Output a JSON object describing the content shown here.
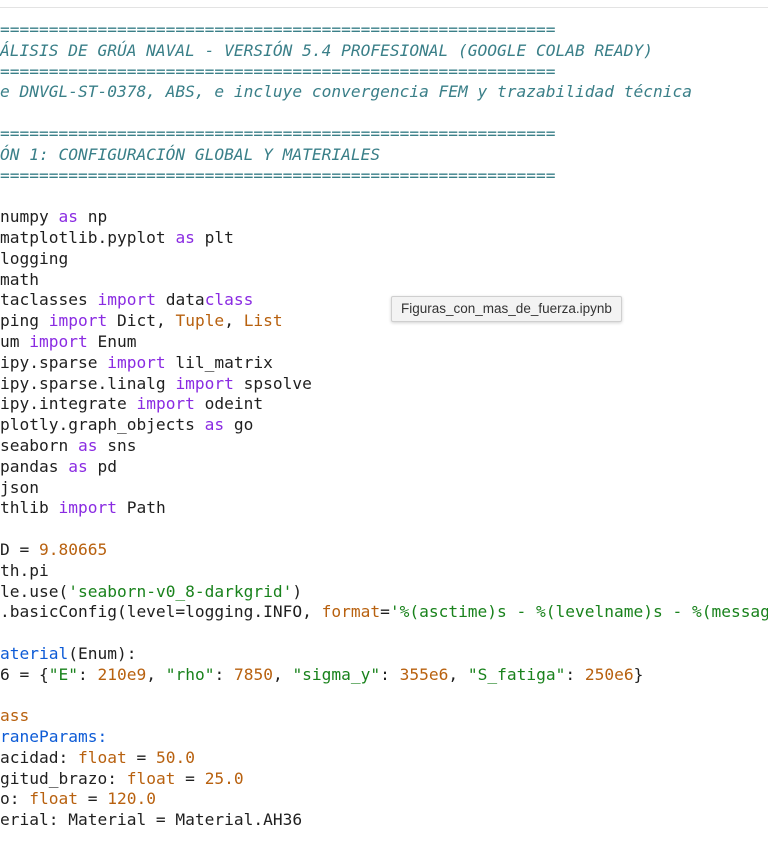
{
  "tooltip": {
    "text": "Figuras_con_mas_de_fuerza.ipynb"
  },
  "code": {
    "l01": "=========================================================",
    "l02": "ÁLISIS DE GRÚA NAVAL - VERSIÓN 5.4 PROFESIONAL (GOOGLE COLAB READY)",
    "l03": "=========================================================",
    "l04": "e DNVGL-ST-0378, ABS, e incluye convergencia FEM y trazabilidad técnica",
    "l05": "",
    "l06": "=========================================================",
    "l07": "ÓN 1: CONFIGURACIÓN GLOBAL Y MATERIALES",
    "l08": "=========================================================",
    "l09": "",
    "l10a": "numpy ",
    "l10b": "as",
    "l10c": " np",
    "l11a": "matplotlib.pyplot ",
    "l11b": "as",
    "l11c": " plt",
    "l12": "logging",
    "l13": "math",
    "l14a": "taclasses ",
    "l14b": "import",
    "l14c": " data",
    "l14d": "class",
    "l15a": "ping ",
    "l15b": "import",
    "l15c": " Dict, ",
    "l15d": "Tuple",
    "l15e": ", ",
    "l15f": "List",
    "l16a": "um ",
    "l16b": "import",
    "l16c": " Enum",
    "l17a": "ipy.sparse ",
    "l17b": "import",
    "l17c": " lil_matrix",
    "l18a": "ipy.sparse.linalg ",
    "l18b": "import",
    "l18c": " spsolve",
    "l19a": "ipy.integrate ",
    "l19b": "import",
    "l19c": " odeint",
    "l20a": "plotly.graph_objects ",
    "l20b": "as",
    "l20c": " go",
    "l21a": "seaborn ",
    "l21b": "as",
    "l21c": " sns",
    "l22a": "pandas ",
    "l22b": "as",
    "l22c": " pd",
    "l23": "json",
    "l24a": "thlib ",
    "l24b": "import",
    "l24c": " Path",
    "l25": "",
    "l26a": "D = ",
    "l26b": "9.80665",
    "l27": "th.pi",
    "l28a": "le.use(",
    "l28b": "'seaborn-v0_8-darkgrid'",
    "l28c": ")",
    "l29a": ".basicConfig(level=logging.INFO, ",
    "l29b": "format",
    "l29c": "=",
    "l29d": "'%(asctime)s - %(levelname)s - %(message",
    "l30": "",
    "l31a": "aterial",
    "l31b": "(Enum):",
    "l32a": "6 = {",
    "l32b": "\"E\"",
    "l32c": ": ",
    "l32d": "210e9",
    "l32e": ", ",
    "l32f": "\"rho\"",
    "l32g": ": ",
    "l32h": "7850",
    "l32i": ", ",
    "l32j": "\"sigma_y\"",
    "l32k": ": ",
    "l32l": "355e6",
    "l32m": ", ",
    "l32n": "\"S_fatiga\"",
    "l32o": ": ",
    "l32p": "250e6",
    "l32q": "}",
    "l33": "",
    "l34": "ass",
    "l35": "raneParams:",
    "l36a": "acidad: ",
    "l36b": "float",
    "l36c": " = ",
    "l36d": "50.0",
    "l37a": "gitud_brazo: ",
    "l37b": "float",
    "l37c": " = ",
    "l37d": "25.0",
    "l38a": "o: ",
    "l38b": "float",
    "l38c": " = ",
    "l38d": "120.0",
    "l39": "erial: Material = Material.AH36"
  }
}
